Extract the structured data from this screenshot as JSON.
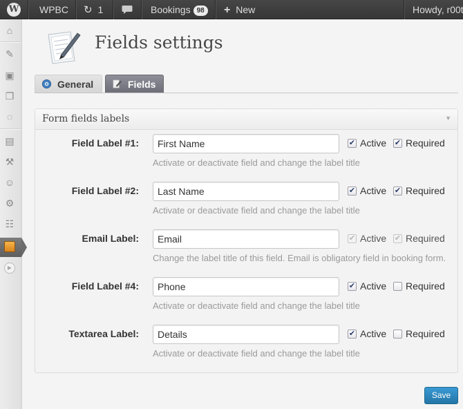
{
  "adminbar": {
    "site_name": "WPBC",
    "updates_count": "1",
    "bookings_label": "Bookings",
    "bookings_badge": "98",
    "new_label": "New",
    "howdy": "Howdy, r00t"
  },
  "header": {
    "title": "Fields settings"
  },
  "tabs": [
    {
      "label": "General",
      "active": false
    },
    {
      "label": "Fields",
      "active": true
    }
  ],
  "postbox": {
    "title": "Form fields labels"
  },
  "fields": [
    {
      "label": "Field Label #1:",
      "value": "First Name",
      "active": true,
      "required": true,
      "disabled": false,
      "active_label": "Active",
      "required_label": "Required",
      "description": "Activate or deactivate field and change the label title"
    },
    {
      "label": "Field Label #2:",
      "value": "Last Name",
      "active": true,
      "required": true,
      "disabled": false,
      "active_label": "Active",
      "required_label": "Required",
      "description": "Activate or deactivate field and change the label title"
    },
    {
      "label": "Email Label:",
      "value": "Email",
      "active": true,
      "required": true,
      "disabled": true,
      "active_label": "Active",
      "required_label": "Required",
      "description": "Change the label title of this field. Email is obligatory field in booking form."
    },
    {
      "label": "Field Label #4:",
      "value": "Phone",
      "active": true,
      "required": false,
      "disabled": false,
      "active_label": "Active",
      "required_label": "Required",
      "description": "Activate or deactivate field and change the label title"
    },
    {
      "label": "Textarea Label:",
      "value": "Details",
      "active": true,
      "required": false,
      "disabled": false,
      "active_label": "Active",
      "required_label": "Required",
      "description": "Activate or deactivate field and change the label title"
    }
  ],
  "save_label": "Save",
  "colors": {
    "adminbar": "#464646",
    "active_tab": "#7d7d87",
    "save_button": "#2e86bf",
    "description_text": "#9a9a9a"
  }
}
